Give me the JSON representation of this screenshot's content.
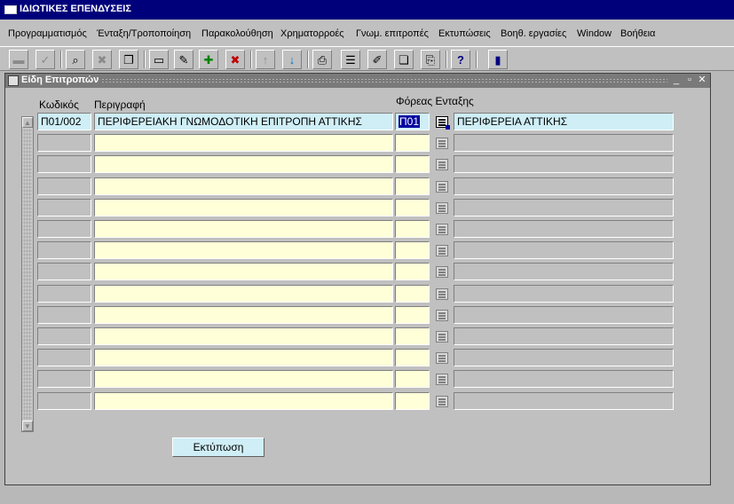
{
  "window": {
    "title": "ΙΔΙΩΤΙΚΕΣ ΕΠΕΝΔΥΣΕΙΣ"
  },
  "menu": [
    "Προγραμματισμός",
    "Ένταξη/Τροποποίηση",
    "Παρακολούθηση",
    "Χρηματορροές",
    "Γνωμ. επιτροπές",
    "Εκτυπώσεις",
    "Βοηθ. εργασίες",
    "Window",
    "Βοήθεια"
  ],
  "toolbar": {
    "icons": [
      "save-icon",
      "accept-icon",
      "search-icon",
      "clear-icon",
      "copy-icon",
      "delete-record-icon",
      "edit-icon",
      "insert-record-icon",
      "remove-record-icon",
      "previous-icon",
      "next-icon",
      "print-icon",
      "list-icon",
      "edit-field-icon",
      "copy-field-icon",
      "paste-icon",
      "help-icon",
      "exit-icon"
    ]
  },
  "form": {
    "title": "Είδη Επιτροπών",
    "headers": {
      "code": "Κωδικός",
      "description": "Περιγραφή",
      "org": "Φόρεας Ενταξης"
    },
    "rows": [
      {
        "code": "Π01/002",
        "description": "ΠΕΡΙΦΕΡΕΙΑΚΗ ΓΝΩΜΟΔΟΤΙΚΗ ΕΠΙΤΡΟΠΗ ΑΤΤΙΚΗΣ",
        "org_code": "Π01",
        "org_name": "ΠΕΡΙΦΕΡΕΙΑ ΑΤΤΙΚΗΣ"
      },
      {
        "code": "",
        "description": "",
        "org_code": "",
        "org_name": ""
      },
      {
        "code": "",
        "description": "",
        "org_code": "",
        "org_name": ""
      },
      {
        "code": "",
        "description": "",
        "org_code": "",
        "org_name": ""
      },
      {
        "code": "",
        "description": "",
        "org_code": "",
        "org_name": ""
      },
      {
        "code": "",
        "description": "",
        "org_code": "",
        "org_name": ""
      },
      {
        "code": "",
        "description": "",
        "org_code": "",
        "org_name": ""
      },
      {
        "code": "",
        "description": "",
        "org_code": "",
        "org_name": ""
      },
      {
        "code": "",
        "description": "",
        "org_code": "",
        "org_name": ""
      },
      {
        "code": "",
        "description": "",
        "org_code": "",
        "org_name": ""
      },
      {
        "code": "",
        "description": "",
        "org_code": "",
        "org_name": ""
      },
      {
        "code": "",
        "description": "",
        "org_code": "",
        "org_name": ""
      },
      {
        "code": "",
        "description": "",
        "org_code": "",
        "org_name": ""
      },
      {
        "code": "",
        "description": "",
        "org_code": "",
        "org_name": ""
      }
    ],
    "print_button": "Εκτύπωση"
  }
}
